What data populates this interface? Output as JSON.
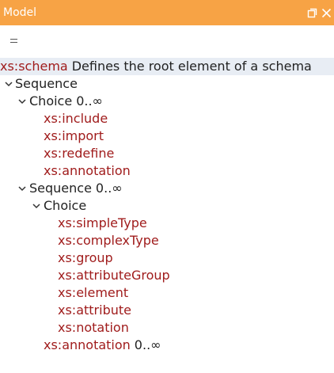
{
  "window": {
    "title": "Model",
    "restore_icon": "restore-window-icon",
    "close_icon": "close-icon"
  },
  "toolbar": {
    "menu_icon": "hamburger-menu-icon"
  },
  "root": {
    "element": "xs:schema",
    "description": "Defines the root element of a schema"
  },
  "tree": {
    "sequence": {
      "label": "Sequence"
    },
    "choice1": {
      "label": "Choice",
      "occurrence": "0..∞"
    },
    "choice1_items": [
      {
        "label": "xs:include"
      },
      {
        "label": "xs:import"
      },
      {
        "label": "xs:redefine"
      },
      {
        "label": "xs:annotation"
      }
    ],
    "sequence2": {
      "label": "Sequence",
      "occurrence": "0..∞"
    },
    "choice2": {
      "label": "Choice"
    },
    "choice2_items": [
      {
        "label": "xs:simpleType"
      },
      {
        "label": "xs:complexType"
      },
      {
        "label": "xs:group"
      },
      {
        "label": "xs:attributeGroup"
      },
      {
        "label": "xs:element"
      },
      {
        "label": "xs:attribute"
      },
      {
        "label": "xs:notation"
      }
    ],
    "annotation2": {
      "label": "xs:annotation",
      "occurrence": "0..∞"
    }
  },
  "colors": {
    "titlebar": "#f7a345",
    "element_text": "#a01c1c",
    "root_row_bg": "#e8edf4"
  }
}
